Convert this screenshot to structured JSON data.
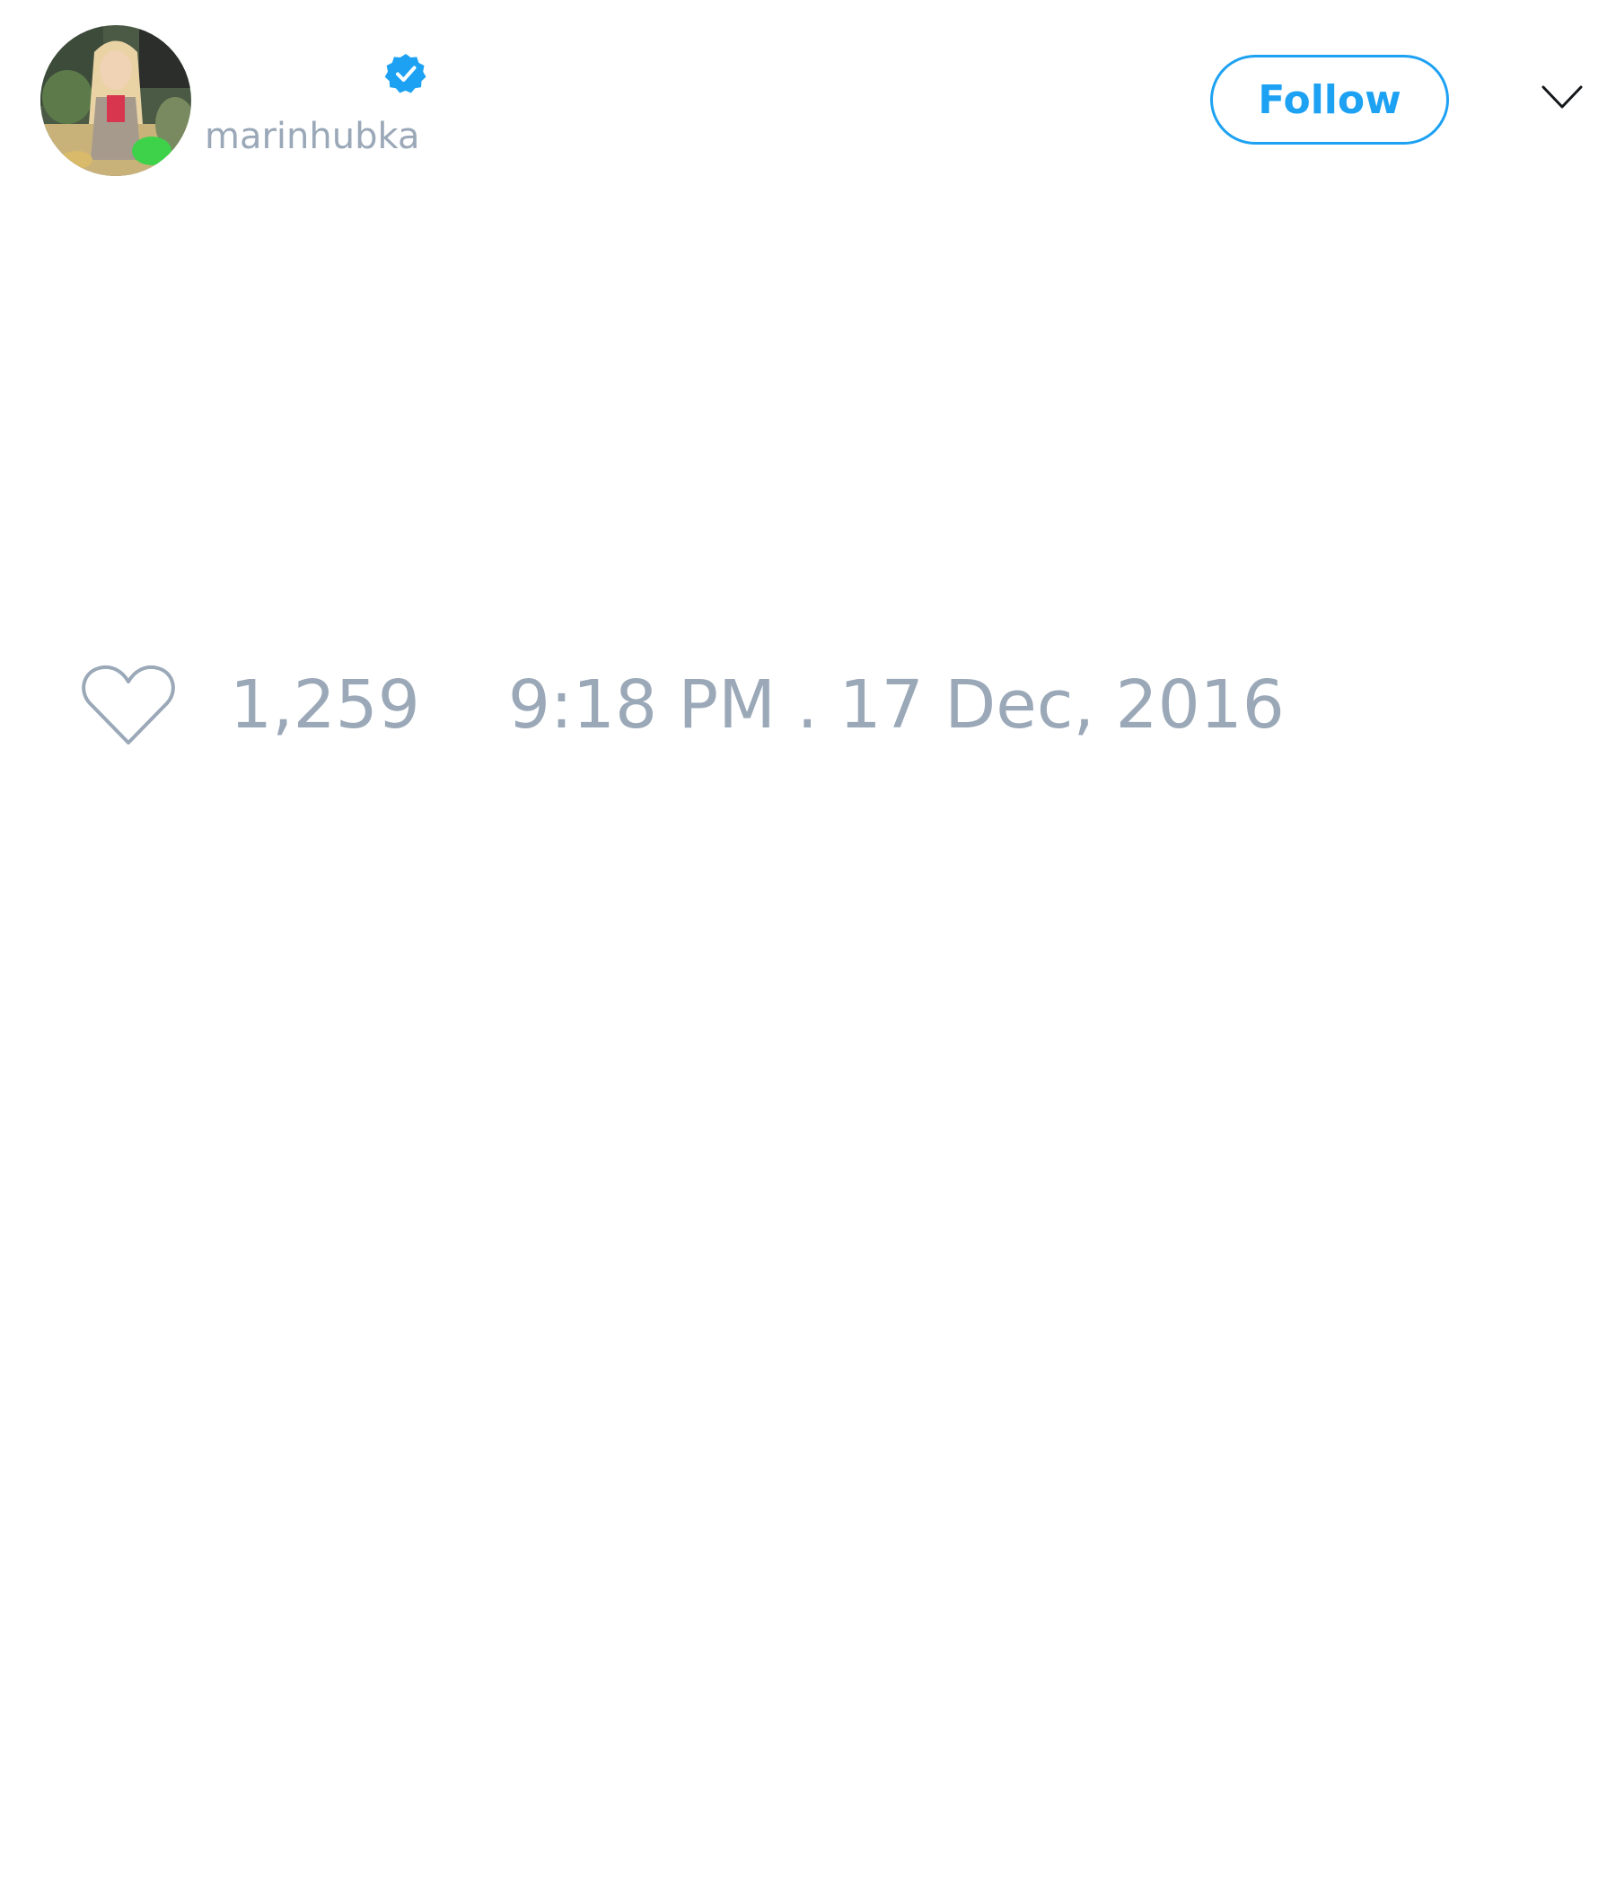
{
  "author": {
    "username": "marinhubka",
    "verified": true,
    "avatar": "profile-photo"
  },
  "header": {
    "follow_label": "Follow",
    "menu_icon": "chevron-down-icon"
  },
  "stats": {
    "like_icon": "heart-icon",
    "likes": "1,259",
    "timestamp": "9:18 PM . 17 Dec, 2016"
  },
  "colors": {
    "accent": "#1da1f2",
    "muted_text": "#9aa8b8",
    "background": "#ffffff"
  }
}
